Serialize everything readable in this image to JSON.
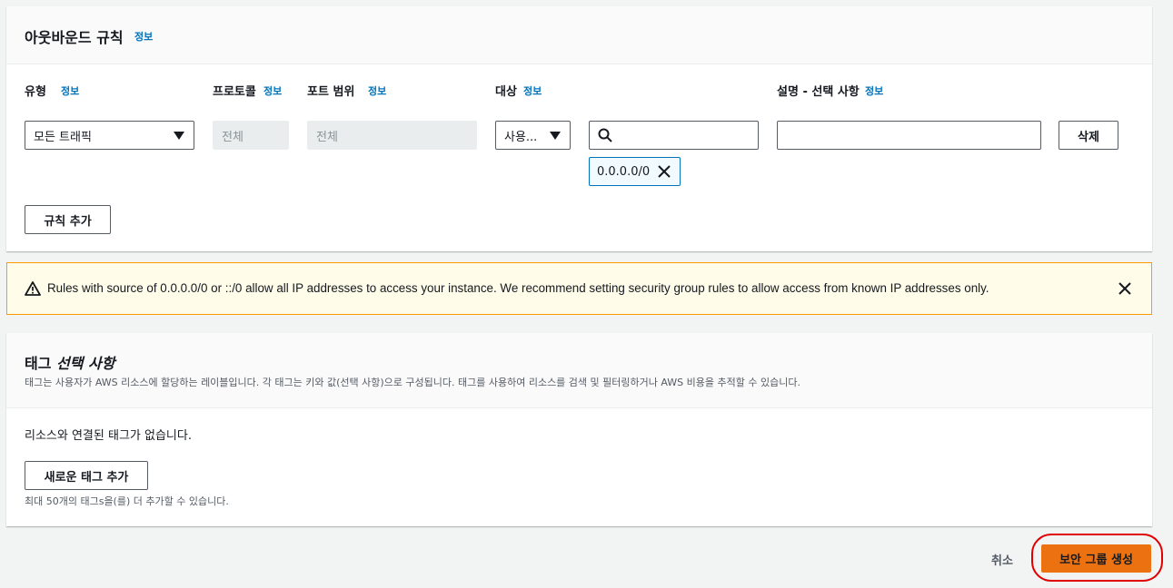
{
  "outbound": {
    "title": "아웃바운드 규칙",
    "info": "정보",
    "headers": {
      "type": "유형",
      "protocol": "프로토콜",
      "port_range": "포트 범위",
      "destination": "대상",
      "description": "설명 - 선택 사항"
    },
    "row": {
      "type_value": "모든 트래픽",
      "protocol_value": "전체",
      "port_value": "전체",
      "dest_select": "사용...",
      "search_value": "",
      "cidr_token": "0.0.0.0/0",
      "description_value": "",
      "delete_label": "삭제"
    },
    "add_rule_label": "규칙 추가"
  },
  "warning": {
    "text": "Rules with source of 0.0.0.0/0 or ::/0 allow all IP addresses to access your instance. We recommend setting security group rules to allow access from known IP addresses only.",
    "icon": "warning-icon"
  },
  "tags": {
    "title": "태그",
    "title_optional": "선택 사항",
    "description": "태그는 사용자가 AWS 리소스에 할당하는 레이블입니다. 각 태그는 키와 값(선택 사항)으로 구성됩니다. 태그를 사용하여 리소스를 검색 및 필터링하거나 AWS 비용을 추적할 수 있습니다.",
    "empty_text": "리소스와 연결된 태그가 없습니다.",
    "add_tag_label": "새로운 태그 추가",
    "limit_text": "최대 50개의 태그s을(를) 더 추가할 수 있습니다."
  },
  "footer": {
    "cancel_label": "취소",
    "create_label": "보안 그룹 생성"
  },
  "colors": {
    "link": "#0073bb",
    "primary": "#ec7211",
    "warning_bg": "#fffce9",
    "highlight": "#e00000"
  }
}
